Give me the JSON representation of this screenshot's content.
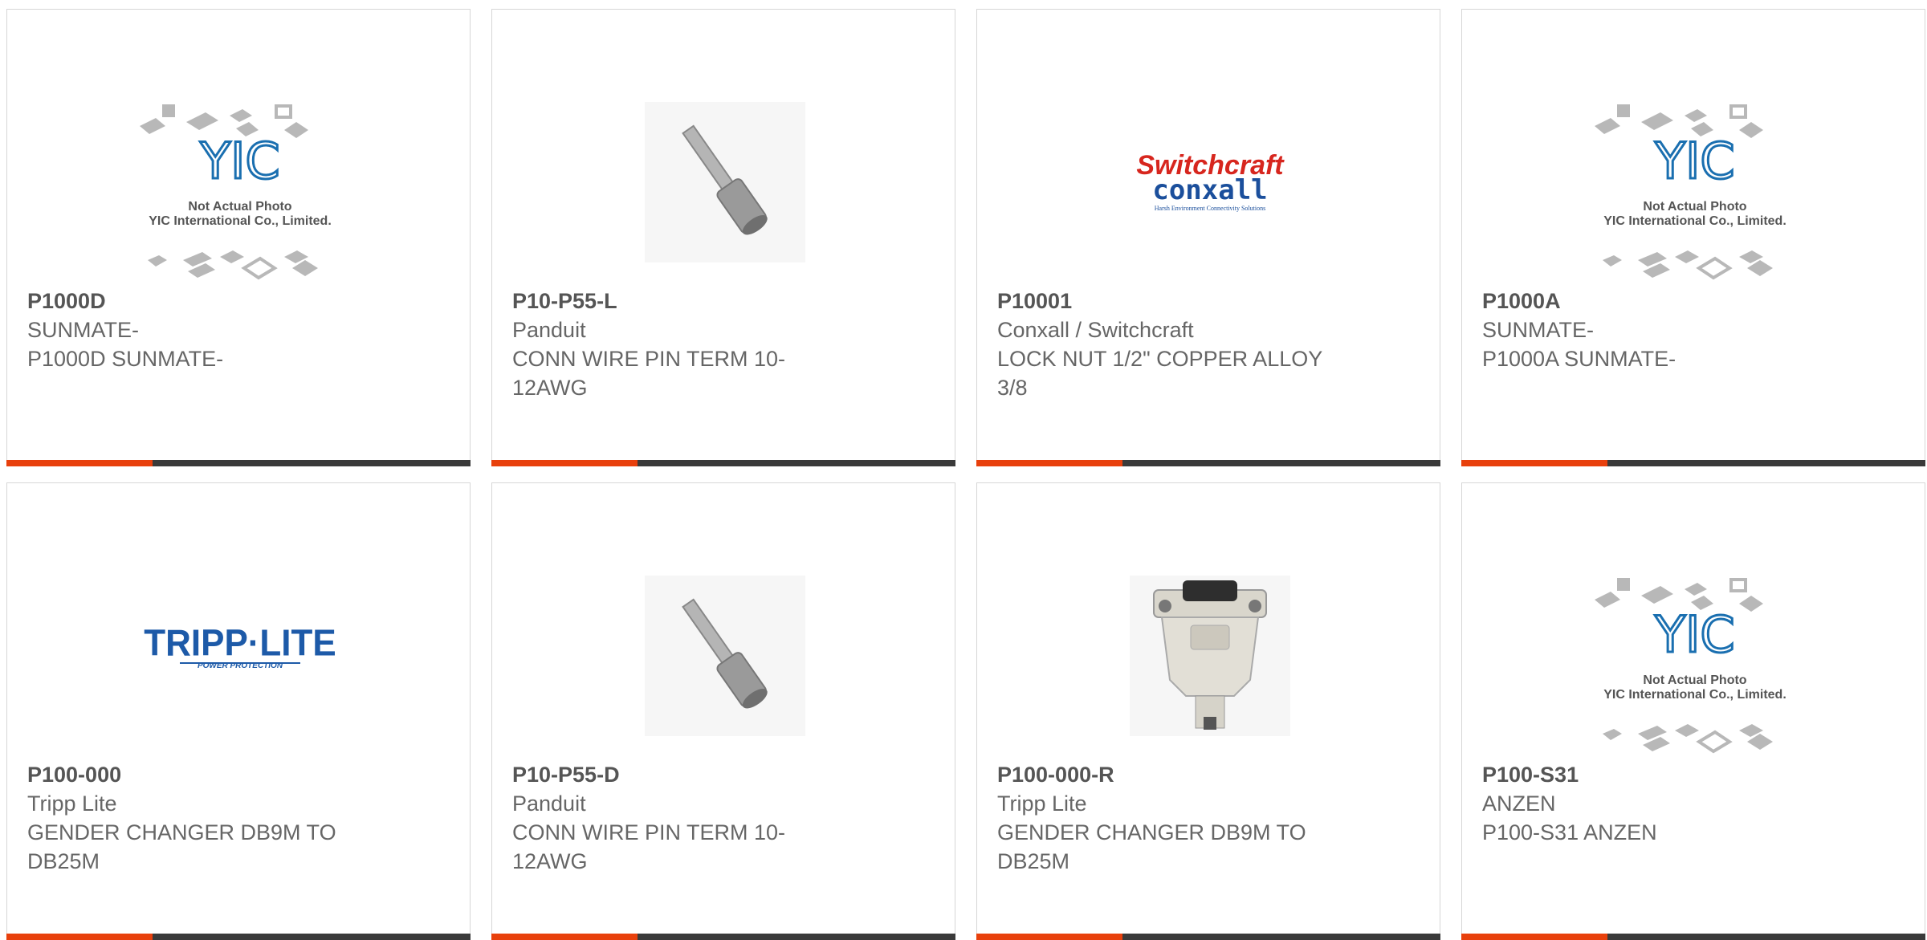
{
  "products": [
    {
      "part": "P1000D",
      "brand": "SUNMATE-",
      "desc": "P1000D SUNMATE-",
      "image": "yic-placeholder",
      "image_text": [
        "YIC",
        "Not Actual Photo",
        "YIC International Co., Limited."
      ]
    },
    {
      "part": "P10-P55-L",
      "brand": "Panduit",
      "desc": "CONN WIRE PIN TERM 10-12AWG",
      "image": "pin-terminal"
    },
    {
      "part": "P10001",
      "brand": "Conxall / Switchcraft",
      "desc": "LOCK NUT 1/2\" COPPER ALLOY 3/8",
      "image": "switchcraft-logo",
      "image_text": [
        "Switchcraft",
        "conxall",
        "Harsh Environment Connectivity Solutions"
      ]
    },
    {
      "part": "P1000A",
      "brand": "SUNMATE-",
      "desc": "P1000A SUNMATE-",
      "image": "yic-placeholder",
      "image_text": [
        "YIC",
        "Not Actual Photo",
        "YIC International Co., Limited."
      ]
    },
    {
      "part": "P100-000",
      "brand": "Tripp Lite",
      "desc": "GENDER CHANGER DB9M TO DB25M",
      "image": "tripplite-logo",
      "image_text": [
        "TRIPP·LITE",
        "POWER PROTECTION"
      ]
    },
    {
      "part": "P10-P55-D",
      "brand": "Panduit",
      "desc": "CONN WIRE PIN TERM 10-12AWG",
      "image": "pin-terminal"
    },
    {
      "part": "P100-000-R",
      "brand": "Tripp Lite",
      "desc": "GENDER CHANGER DB9M TO DB25M",
      "image": "gender-changer"
    },
    {
      "part": "P100-S31",
      "brand": "ANZEN",
      "desc": "P100-S31 ANZEN",
      "image": "yic-placeholder",
      "image_text": [
        "YIC",
        "Not Actual Photo",
        "YIC International Co., Limited."
      ]
    }
  ],
  "colors": {
    "accent": "#e8400c",
    "bar": "#3a3a3a",
    "text": "#666666",
    "border": "#d6d6d6",
    "yic_blue": "#1a6fb0",
    "switchcraft_red": "#d7261e",
    "conxall_blue": "#1b4f9c",
    "tripp_blue": "#1d5aa8"
  }
}
